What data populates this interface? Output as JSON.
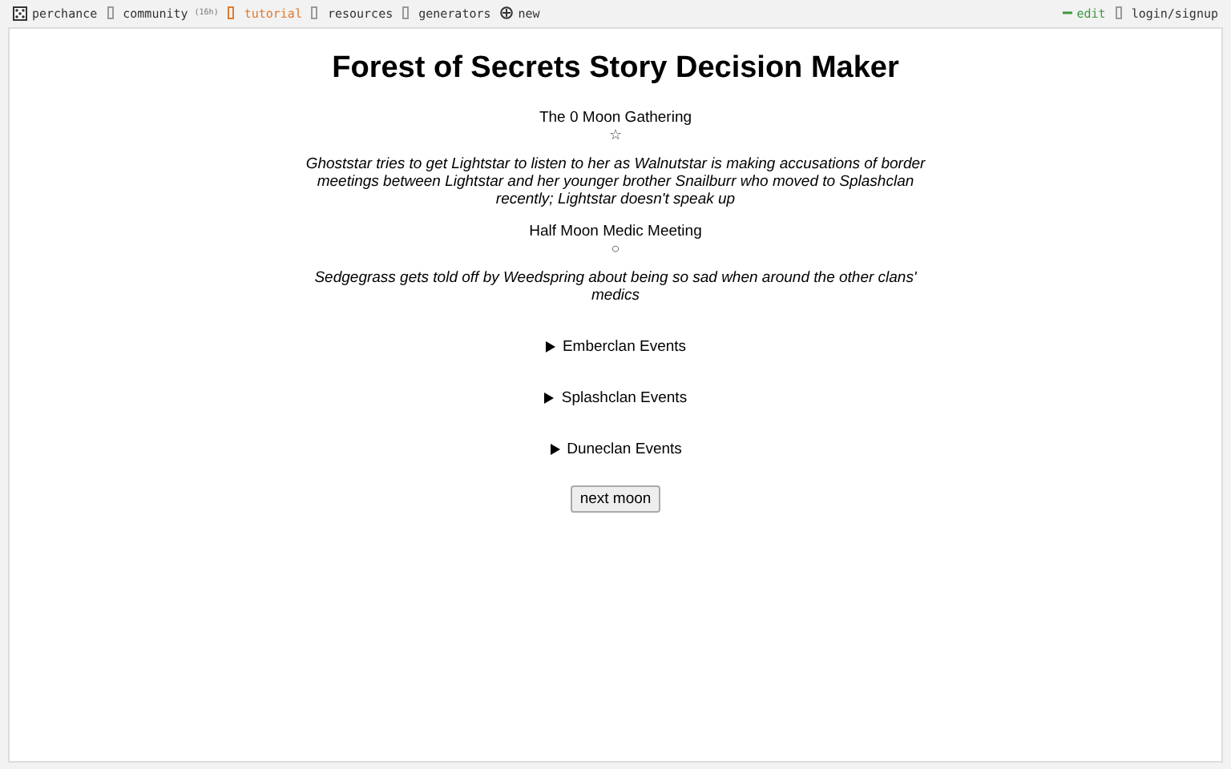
{
  "nav": {
    "left": [
      {
        "kind": "logo",
        "label": "perchance"
      },
      {
        "kind": "link",
        "label": "community",
        "badge": "(16h)"
      },
      {
        "kind": "link",
        "label": "tutorial",
        "highlight": true
      },
      {
        "kind": "link",
        "label": "resources"
      },
      {
        "kind": "link",
        "label": "generators"
      },
      {
        "kind": "new",
        "label": "new"
      }
    ],
    "right": [
      {
        "kind": "edit",
        "label": "edit"
      },
      {
        "kind": "link",
        "label": "login/signup"
      }
    ]
  },
  "title": "Forest of Secrets Story Decision Maker",
  "events": [
    {
      "heading": "The 0 Moon Gathering",
      "symbol": "☆",
      "text": "Ghoststar tries to get Lightstar to listen to her as Walnutstar is making accusations of border meetings between Lightstar and her younger brother Snailburr who moved to Splashclan recently; Lightstar doesn't speak up"
    },
    {
      "heading": "Half Moon Medic Meeting",
      "symbol": "○",
      "text": "Sedgegrass gets told off by Weedspring about being so sad when around the other clans' medics"
    }
  ],
  "sections": [
    {
      "label": "Emberclan Events",
      "expanded": false
    },
    {
      "label": "Splashclan Events",
      "expanded": false
    },
    {
      "label": "Duneclan Events",
      "expanded": false
    }
  ],
  "button": "next moon"
}
